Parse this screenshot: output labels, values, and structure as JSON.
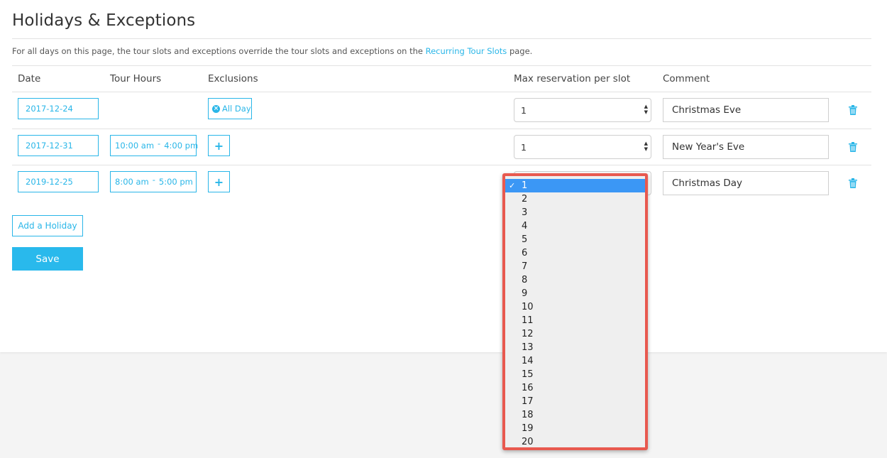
{
  "page": {
    "title": "Holidays & Exceptions",
    "note_prefix": "For all days on this page, the tour slots and exceptions override the tour slots and exceptions on the",
    "note_link": "Recurring Tour Slots",
    "note_suffix": "page."
  },
  "table": {
    "headers": {
      "date": "Date",
      "hours": "Tour Hours",
      "exclusions": "Exclusions",
      "max": "Max reservation per slot",
      "comment": "Comment"
    },
    "rows": [
      {
        "date": "2017-12-24",
        "hours_start": "",
        "hours_end": "",
        "exclusion": "All Day",
        "max": "1",
        "comment": "Christmas Eve"
      },
      {
        "date": "2017-12-31",
        "hours_start": "10:00 am",
        "hours_end": "4:00 pm",
        "exclusion": "+",
        "max": "1",
        "comment": "New Year's Eve"
      },
      {
        "date": "2019-12-25",
        "hours_start": "8:00 am",
        "hours_end": "5:00 pm",
        "exclusion": "+",
        "max": "1",
        "comment": "Christmas Day"
      }
    ]
  },
  "dropdown": {
    "selected": "1",
    "options": [
      "1",
      "2",
      "3",
      "4",
      "5",
      "6",
      "7",
      "8",
      "9",
      "10",
      "11",
      "12",
      "13",
      "14",
      "15",
      "16",
      "17",
      "18",
      "19",
      "20"
    ]
  },
  "buttons": {
    "add_holiday": "Add a Holiday",
    "save": "Save"
  },
  "icons": {
    "trash": "trash-icon",
    "remove": "x-circle-icon",
    "check": "checkmark-icon",
    "select_arrows": "updown-arrows-icon"
  },
  "colors": {
    "accent": "#29b6e8",
    "highlight_border": "#e8594f",
    "selected_option": "#3b97f5"
  }
}
